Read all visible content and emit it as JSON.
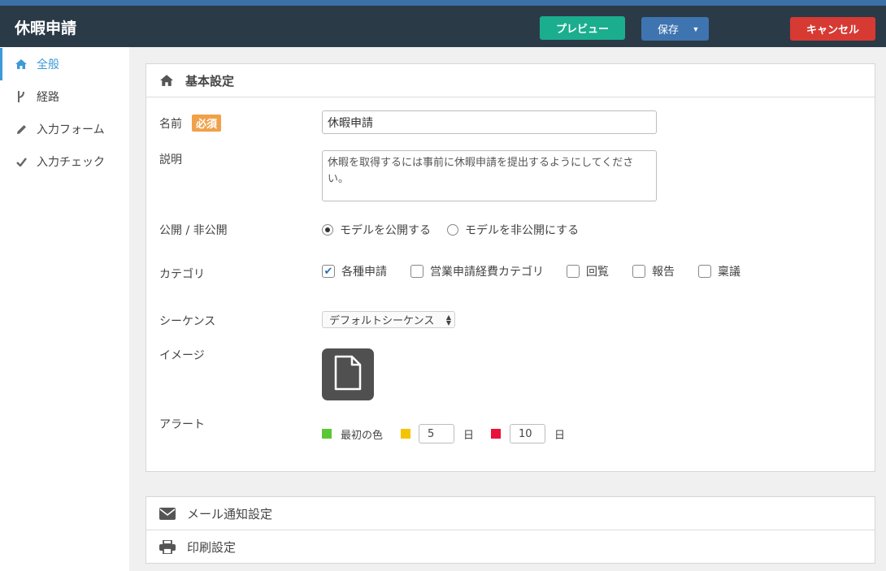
{
  "header": {
    "title": "休暇申請",
    "preview_label": "プレビュー",
    "save_label": "保存",
    "cancel_label": "キャンセル"
  },
  "sidebar": {
    "items": [
      {
        "label": "全般",
        "icon": "home-icon",
        "active": true
      },
      {
        "label": "経路",
        "icon": "branch-icon",
        "active": false
      },
      {
        "label": "入力フォーム",
        "icon": "pencil-icon",
        "active": false
      },
      {
        "label": "入力チェック",
        "icon": "check-icon",
        "active": false
      }
    ]
  },
  "basic": {
    "title": "基本設定",
    "name_label": "名前",
    "required_badge": "必須",
    "name_value": "休暇申請",
    "desc_label": "説明",
    "desc_value": "休暇を取得するには事前に休暇申請を提出するようにしてください。",
    "visibility_label": "公開 / 非公開",
    "visibility_options": [
      "モデルを公開する",
      "モデルを非公開にする"
    ],
    "visibility_selected": 0,
    "category_label": "カテゴリ",
    "categories": [
      {
        "label": "各種申請",
        "checked": true
      },
      {
        "label": "営業申請経費カテゴリ",
        "checked": false
      },
      {
        "label": "回覧",
        "checked": false
      },
      {
        "label": "報告",
        "checked": false
      },
      {
        "label": "稟議",
        "checked": false
      }
    ],
    "sequence_label": "シーケンス",
    "sequence_value": "デフォルトシーケンス",
    "image_label": "イメージ",
    "alert_label": "アラート",
    "alert_first_color": "最初の色",
    "alert_yellow_days": "5",
    "alert_red_days": "10",
    "day_unit": "日",
    "colors": {
      "green": "#5cc735",
      "yellow": "#f5c400",
      "red": "#e8123c"
    }
  },
  "mail": {
    "title": "メール通知設定"
  },
  "print": {
    "title": "印刷設定"
  }
}
